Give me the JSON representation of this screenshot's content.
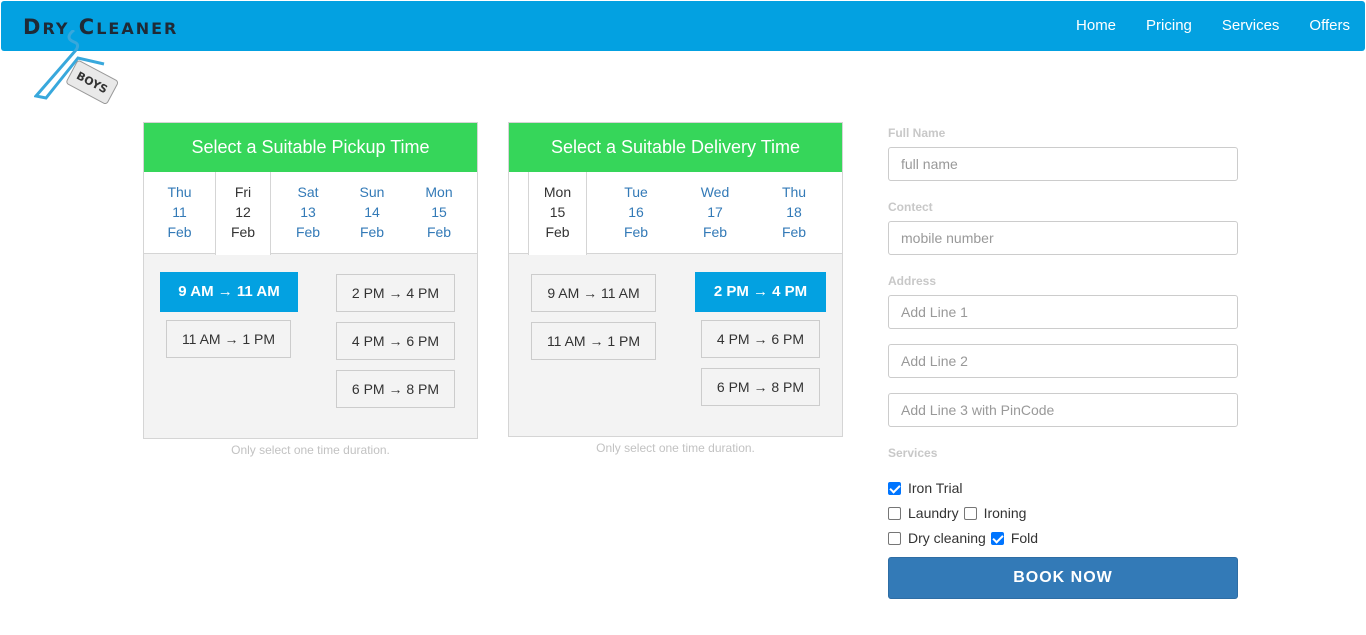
{
  "brand": {
    "name_first": "D",
    "name_first_rest": "RY",
    "name_second": "C",
    "name_second_rest": "LEANER",
    "tag": "BOYS"
  },
  "nav": [
    {
      "label": "Home"
    },
    {
      "label": "Pricing"
    },
    {
      "label": "Services"
    },
    {
      "label": "Offers"
    }
  ],
  "pickup": {
    "title": "Select a Suitable Pickup Time",
    "days": [
      {
        "dow": "Thu",
        "date": "11",
        "month": "Feb"
      },
      {
        "dow": "Fri",
        "date": "12",
        "month": "Feb"
      },
      {
        "dow": "Sat",
        "date": "13",
        "month": "Feb"
      },
      {
        "dow": "Sun",
        "date": "14",
        "month": "Feb"
      },
      {
        "dow": "Mon",
        "date": "15",
        "month": "Feb"
      }
    ],
    "slots": [
      {
        "label": "9 AM → 11 AM"
      },
      {
        "label": "11 AM → 1 PM"
      },
      {
        "label": "2 PM → 4 PM"
      },
      {
        "label": "4 PM → 6 PM"
      },
      {
        "label": "6 PM → 8 PM"
      }
    ],
    "hint": "Only select one time duration."
  },
  "delivery": {
    "title": "Select a Suitable Delivery Time",
    "days": [
      {
        "dow": "Mon",
        "date": "15",
        "month": "Feb"
      },
      {
        "dow": "Tue",
        "date": "16",
        "month": "Feb"
      },
      {
        "dow": "Wed",
        "date": "17",
        "month": "Feb"
      },
      {
        "dow": "Thu",
        "date": "18",
        "month": "Feb"
      }
    ],
    "slots": [
      {
        "label": "9 AM → 11 AM"
      },
      {
        "label": "11 AM → 1 PM"
      },
      {
        "label": "2 PM → 4 PM"
      },
      {
        "label": "4 PM → 6 PM"
      },
      {
        "label": "6 PM → 8 PM"
      }
    ],
    "hint": "Only select one time duration."
  },
  "form": {
    "full_name_label": "Full Name",
    "full_name_placeholder": "full name",
    "contact_label": "Contect",
    "contact_placeholder": "mobile number",
    "address_label": "Address",
    "address_line1_placeholder": "Add Line 1",
    "address_line2_placeholder": "Add Line 2",
    "address_line3_placeholder": "Add Line 3 with PinCode",
    "services_label": "Services",
    "services": [
      {
        "label": "Iron Trial",
        "checked": true
      },
      {
        "label": "Laundry",
        "checked": false
      },
      {
        "label": "Ironing",
        "checked": false
      },
      {
        "label": "Dry cleaning",
        "checked": false
      },
      {
        "label": "Fold",
        "checked": true
      }
    ],
    "submit_label": "BOOK NOW"
  },
  "colors": {
    "navbar": "#03a1e1",
    "panel_header": "#36d65a",
    "active_slot": "#03a1e1",
    "book_button": "#337ab7"
  }
}
